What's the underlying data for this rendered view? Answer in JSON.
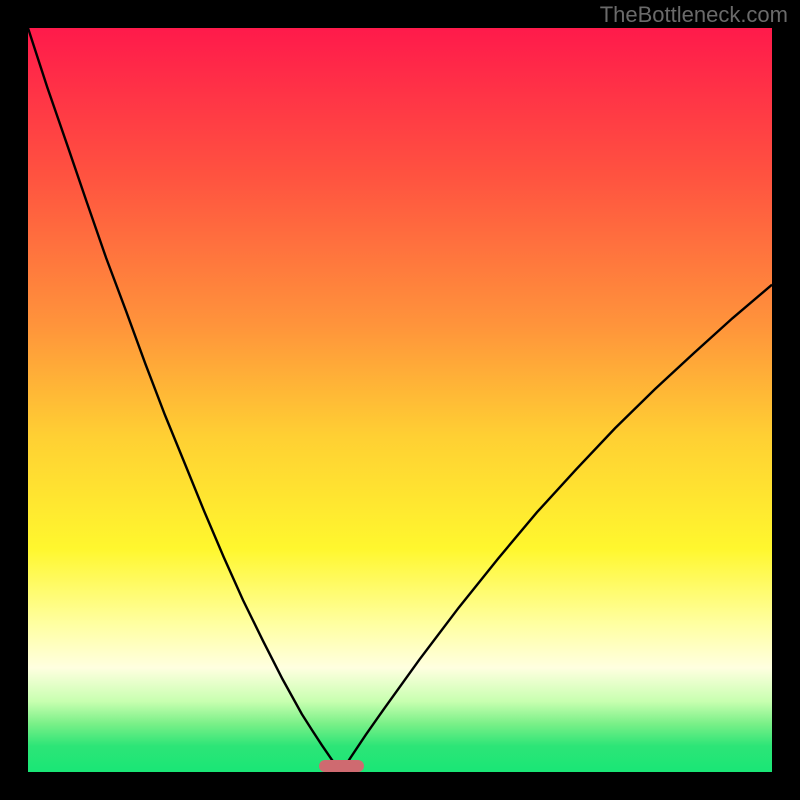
{
  "watermark": "TheBottleneck.com",
  "chart_data": {
    "type": "line",
    "title": "",
    "xlabel": "",
    "ylabel": "",
    "xlim": [
      0,
      100
    ],
    "ylim": [
      0,
      100
    ],
    "grid": false,
    "legend": false,
    "gradient_stops": [
      {
        "pos": 0.0,
        "color": "#ff1a4b"
      },
      {
        "pos": 0.2,
        "color": "#ff5340"
      },
      {
        "pos": 0.4,
        "color": "#ff943b"
      },
      {
        "pos": 0.55,
        "color": "#ffd033"
      },
      {
        "pos": 0.7,
        "color": "#fff72e"
      },
      {
        "pos": 0.8,
        "color": "#ffffa0"
      },
      {
        "pos": 0.86,
        "color": "#ffffe0"
      },
      {
        "pos": 0.905,
        "color": "#c8ffb0"
      },
      {
        "pos": 0.935,
        "color": "#7af088"
      },
      {
        "pos": 0.965,
        "color": "#2de577"
      },
      {
        "pos": 1.0,
        "color": "#19e676"
      }
    ],
    "series": [
      {
        "name": "left-curve",
        "x": [
          0.0,
          2.6,
          5.3,
          7.9,
          10.5,
          13.2,
          15.8,
          18.4,
          21.1,
          23.7,
          26.3,
          28.9,
          31.6,
          34.2,
          36.8,
          38.2,
          39.5,
          40.8,
          42.1
        ],
        "y": [
          100.0,
          92.0,
          84.2,
          76.6,
          69.1,
          61.9,
          54.8,
          48.0,
          41.4,
          35.0,
          28.9,
          23.1,
          17.6,
          12.5,
          7.8,
          5.6,
          3.6,
          1.7,
          0.0
        ]
      },
      {
        "name": "right-curve",
        "x": [
          42.1,
          43.4,
          45.4,
          48.0,
          52.6,
          57.9,
          63.2,
          68.4,
          73.7,
          78.9,
          84.2,
          89.5,
          94.7,
          100.0
        ],
        "y": [
          0.0,
          2.0,
          5.0,
          8.7,
          15.1,
          22.1,
          28.7,
          34.9,
          40.7,
          46.2,
          51.4,
          56.3,
          61.0,
          65.5
        ]
      }
    ],
    "marker": {
      "name": "bottleneck-marker",
      "x_center": 42.1,
      "y": 0,
      "width_pct": 6.0,
      "height_pct": 1.6,
      "color": "#cf6a70"
    }
  }
}
